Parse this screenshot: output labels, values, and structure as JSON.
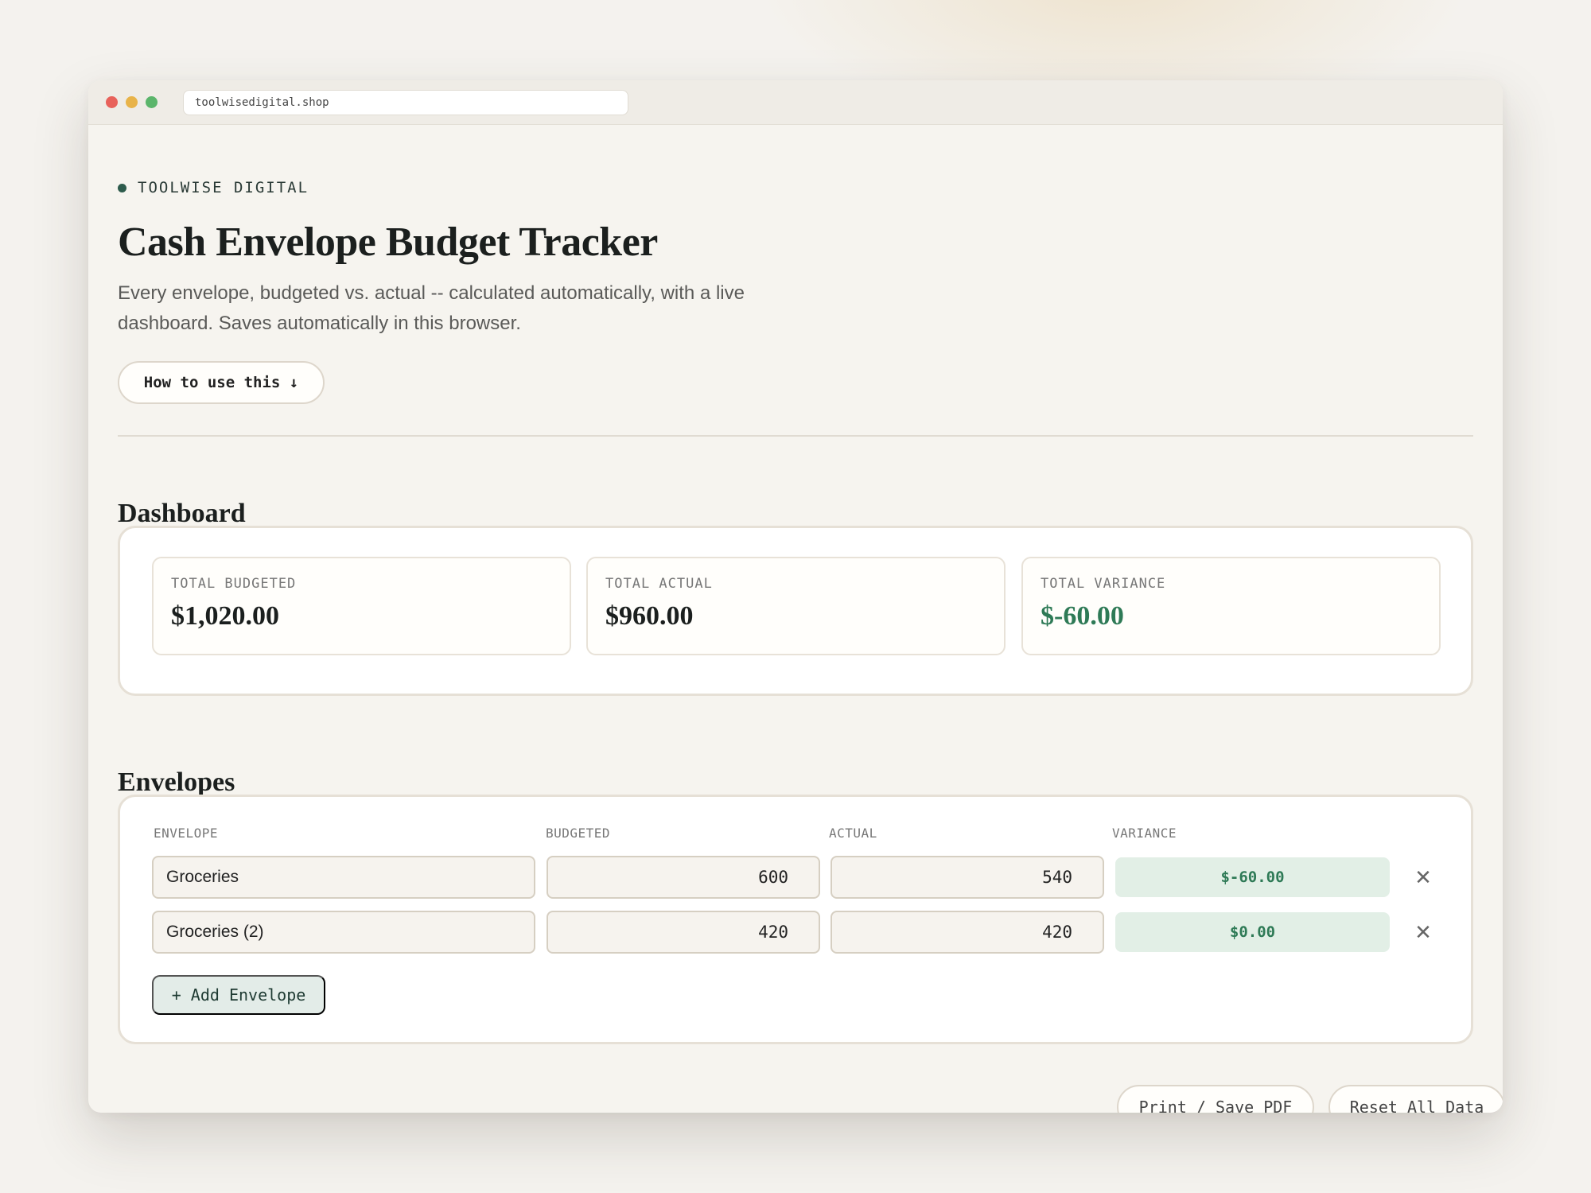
{
  "browser": {
    "url": "toolwisedigital.shop"
  },
  "header": {
    "brand": "TOOLWISE DIGITAL",
    "title": "Cash Envelope Budget Tracker",
    "subtitle": "Every envelope, budgeted vs. actual -- calculated automatically, with a live dashboard. Saves automatically in this browser.",
    "how_to_label": "How to use this ↓"
  },
  "dashboard": {
    "title": "Dashboard",
    "stats": [
      {
        "label": "TOTAL BUDGETED",
        "value": "$1,020.00"
      },
      {
        "label": "TOTAL ACTUAL",
        "value": "$960.00"
      },
      {
        "label": "TOTAL VARIANCE",
        "value": "$-60.00"
      }
    ]
  },
  "envelopes": {
    "title": "Envelopes",
    "columns": [
      "ENVELOPE",
      "BUDGETED",
      "ACTUAL",
      "VARIANCE"
    ],
    "rows": [
      {
        "name": "Groceries",
        "budgeted": "600",
        "actual": "540",
        "variance": "$-60.00"
      },
      {
        "name": "Groceries (2)",
        "budgeted": "420",
        "actual": "420",
        "variance": "$0.00"
      }
    ],
    "remove_glyph": "✕",
    "add_label": "+ Add Envelope"
  },
  "footer": {
    "print_label": "Print / Save PDF",
    "reset_label": "Reset All Data"
  },
  "colors": {
    "accent": "#2d5b4c",
    "positive": "#2e7a56",
    "background": "#f4f2ee"
  }
}
